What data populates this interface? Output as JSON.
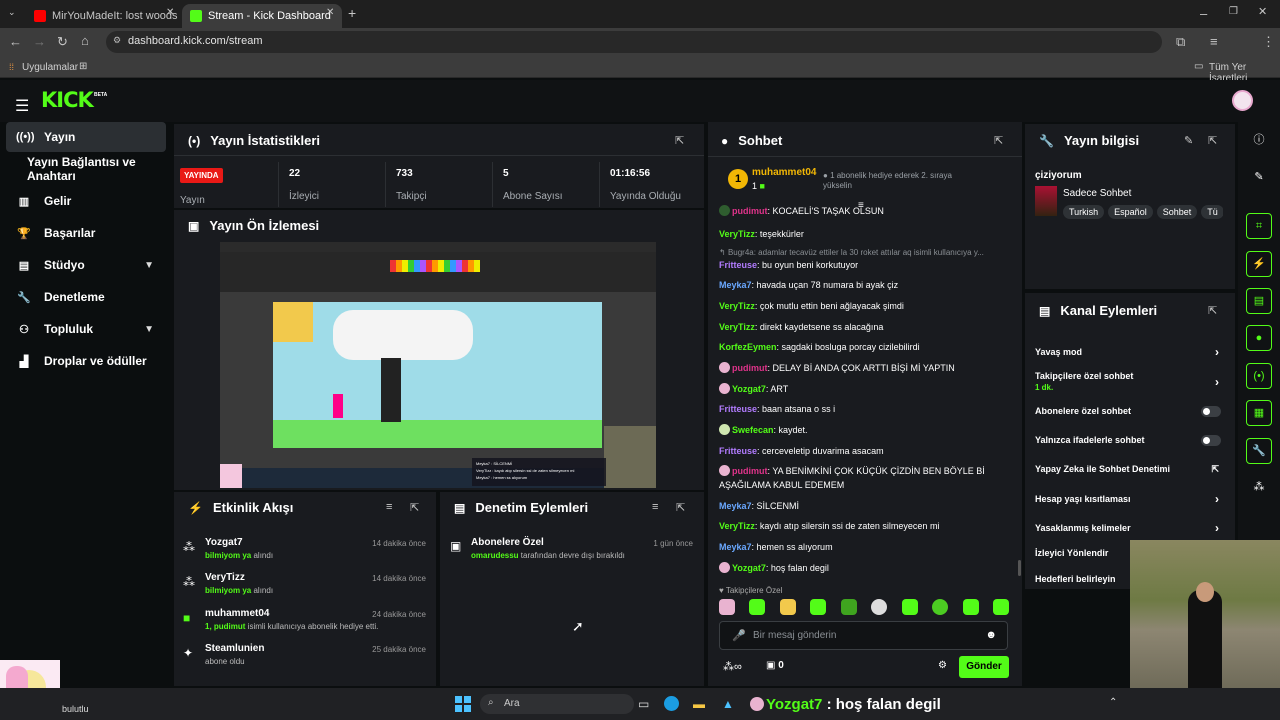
{
  "browser": {
    "tab1": "MirYouMadeIt: lost woods |",
    "tab2": "Stream - Kick Dashboard",
    "url": "dashboard.kick.com/stream",
    "bookmark_apps": "Uygulamalar",
    "bookmark_all": "Tüm Yer İşaretleri"
  },
  "header": {
    "logo": "KICK",
    "beta": "BETA"
  },
  "sidebar": {
    "items": [
      {
        "label": "Yayın",
        "icon": "broadcast-icon"
      },
      {
        "label": "Yayın Bağlantısı ve Anahtarı"
      },
      {
        "label": "Gelir",
        "icon": "chart-icon"
      },
      {
        "label": "Başarılar",
        "icon": "trophy-icon"
      },
      {
        "label": "Stüdyo",
        "icon": "studio-icon"
      },
      {
        "label": "Denetleme",
        "icon": "wrench-icon"
      },
      {
        "label": "Topluluk",
        "icon": "community-icon"
      },
      {
        "label": "Droplar ve ödüller",
        "icon": "drops-icon"
      }
    ]
  },
  "stats": {
    "title": "Yayın İstatistikleri",
    "live_badge": "YAYINDA",
    "live_label": "Yayın",
    "items": [
      {
        "value": "22",
        "label": "İzleyici"
      },
      {
        "value": "733",
        "label": "Takipçi"
      },
      {
        "value": "5",
        "label": "Abone Sayısı"
      },
      {
        "value": "01:16:56",
        "label": "Yayında Olduğu"
      }
    ]
  },
  "preview": {
    "title": "Yayın Ön İzlemesi",
    "overlay_line1": "Meyka7 : SİLCENMİ",
    "overlay_line2": "VeryTizz : kaydı atıp silersin ssi de zaten silmeyecen mi",
    "overlay_line3": "Meyka7 : hemen ss alıyorum"
  },
  "activity": {
    "title": "Etkinlik Akışı",
    "items": [
      {
        "name": "Yozgat7",
        "time": "14 dakika önce",
        "hl": "bilmiyom ya",
        "sub": " alındı"
      },
      {
        "name": "VeryTizz",
        "time": "14 dakika önce",
        "hl": "bilmiyom ya",
        "sub": " alındı"
      },
      {
        "name": "muhammet04",
        "time": "24 dakika önce",
        "hl": "1, pudimut",
        "sub": " isimli kullanıcıya abonelik hediye etti."
      },
      {
        "name": "Steamlunien",
        "time": "25 dakika önce",
        "hl": "",
        "sub": "abone oldu"
      }
    ]
  },
  "moderation": {
    "title": "Denetim Eylemleri",
    "item_title": "Abonelere Özel",
    "item_time": "1 gün önce",
    "item_user": "omarudessu",
    "item_text": " tarafından devre dışı bırakıldı"
  },
  "chat": {
    "title": "Sohbet",
    "pinned_user": "muhammet04",
    "pinned_rank": "1",
    "pinned_count": "1",
    "pinned_text": "1 abonelik hediye ederek 2. sıraya yükselin",
    "messages": [
      {
        "user": "pudimut",
        "color": "#e0338b",
        "text": ": KOCAELİ'S TAŞAK OLSUN"
      },
      {
        "user": "VeryTizz",
        "color": "#53fc18",
        "text": ": teşekkürler"
      },
      {
        "user": "Bugr4a",
        "color": "#8a8f94",
        "text": ": adamlar tecavüz ettiler la 30 roket attılar aq isimli kullanıcıya y..."
      },
      {
        "user": "Fritteuse",
        "color": "#b27cff",
        "text": ": bu oyun beni korkutuyor"
      },
      {
        "user": "Meyka7",
        "color": "#6aa8ff",
        "text": ": havada uçan 78 numara bi ayak çiz"
      },
      {
        "user": "VeryTizz",
        "color": "#53fc18",
        "text": ": çok mutlu ettin beni ağlayacak şimdi"
      },
      {
        "user": "VeryTizz",
        "color": "#53fc18",
        "text": ": direkt kaydetsene ss alacağına"
      },
      {
        "user": "KorfezEymen",
        "color": "#53fc18",
        "text": ": sagdaki bosluga porcay cizilebilirdi"
      },
      {
        "user": "pudimut",
        "color": "#e0338b",
        "text": ": DELAY Bİ ANDA ÇOK ARTTI BİŞİ Mİ YAPTIN"
      },
      {
        "user": "Yozgat7",
        "color": "#53fc18",
        "text": ": ART"
      },
      {
        "user": "Fritteuse",
        "color": "#b27cff",
        "text": ": baan atsana o ss i"
      },
      {
        "user": "Swefecan",
        "color": "#53fc18",
        "text": ": kaydet."
      },
      {
        "user": "Fritteuse",
        "color": "#b27cff",
        "text": ": cerceveletip duvarima asacam"
      },
      {
        "user": "pudimut",
        "color": "#e0338b",
        "text": ": YA BENİMKİNİ ÇOK KÜÇÜK ÇİZDİN BEN BÖYLE Bİ AŞAĞILAMA KABUL EDEMEM"
      },
      {
        "user": "Meyka7",
        "color": "#6aa8ff",
        "text": ": SİLCENMİ"
      },
      {
        "user": "VeryTizz",
        "color": "#53fc18",
        "text": ": kaydı atıp silersin ssi de zaten silmeyecen mi"
      },
      {
        "user": "Meyka7",
        "color": "#6aa8ff",
        "text": ": hemen ss alıyorum"
      },
      {
        "user": "Yozgat7",
        "color": "#53fc18",
        "text": ": hoş falan degil"
      }
    ],
    "emote_label": "Takipçilere Özel",
    "input_placeholder": "Bir mesaj gönderin",
    "footer_count": "0",
    "send": "Gönder"
  },
  "info": {
    "title": "Yayın bilgisi",
    "status": "çiziyorum",
    "category": "Sadece Sohbet",
    "tags": [
      "Turkish",
      "Español",
      "Sohbet",
      "Tü"
    ]
  },
  "channel": {
    "title": "Kanal Eylemleri",
    "items": [
      {
        "label": "Yavaş mod",
        "control": "arrow"
      },
      {
        "label": "Takipçilere özel sohbet",
        "control": "arrow",
        "sub": "1 dk."
      },
      {
        "label": "Abonelere özel sohbet",
        "control": "toggle"
      },
      {
        "label": "Yalnızca ifadelerle sohbet",
        "control": "toggle"
      },
      {
        "label": "Yapay Zeka ile Sohbet Denetimi",
        "control": "external"
      },
      {
        "label": "Hesap yaşı kısıtlaması",
        "control": "arrow"
      },
      {
        "label": "Yasaklanmış kelimeler",
        "control": "arrow"
      },
      {
        "label": "İzleyici Yönlendir",
        "control": ""
      },
      {
        "label": "Hedefleri belirleyin",
        "control": ""
      }
    ]
  },
  "taskbar": {
    "weather": "bulutlu",
    "search": "Ara",
    "overlay_user": "Yozgat7",
    "overlay_text": " : hoş falan degil"
  },
  "colors": {
    "accent": "#53fc18",
    "live": "#e91916",
    "panel": "#191b1f",
    "bg": "#0b0e0f"
  }
}
